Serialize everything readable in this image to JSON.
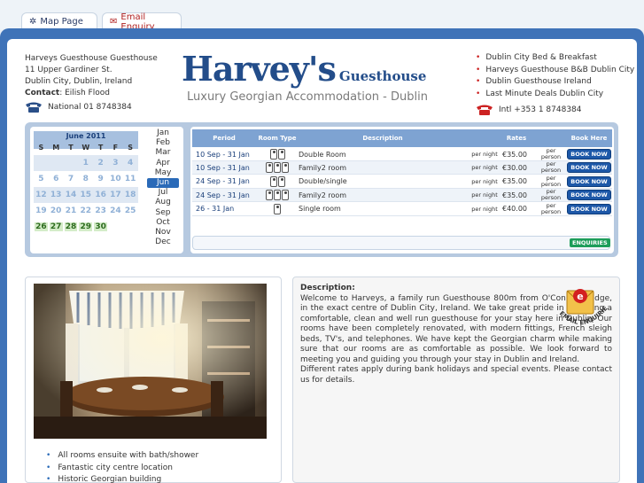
{
  "tabs": [
    {
      "label": "Map Page",
      "icon": "map-icon"
    },
    {
      "label": "Email Enquiry",
      "icon": "envelope-icon"
    }
  ],
  "address": {
    "line1": "Harveys Guesthouse Guesthouse",
    "line2": "11 Upper Gardiner St.",
    "line3": "Dublin City, Dublin, Ireland",
    "contact_label": "Contact",
    "contact_name": ": Eilish Flood",
    "phone": "National 01 8748384"
  },
  "logo": {
    "name": "Harvey's",
    "suffix": "Guesthouse",
    "tagline": "Luxury Georgian Accommodation - Dublin"
  },
  "right_links": [
    "Dublin City Bed & Breakfast",
    "Harveys Guesthouse B&B Dublin City",
    "Dublin Guesthouse Ireland",
    "Last Minute Deals Dublin City"
  ],
  "intl_phone": "Intl +353 1 8748384",
  "calendar": {
    "title": "June 2011",
    "dow": [
      "S",
      "M",
      "T",
      "W",
      "T",
      "F",
      "S"
    ],
    "weeks": [
      [
        "",
        "",
        "",
        "1",
        "2",
        "3",
        "4"
      ],
      [
        "5",
        "6",
        "7",
        "8",
        "9",
        "10",
        "11"
      ],
      [
        "12",
        "13",
        "14",
        "15",
        "16",
        "17",
        "18"
      ],
      [
        "19",
        "20",
        "21",
        "22",
        "23",
        "24",
        "25"
      ],
      [
        "26",
        "27",
        "28",
        "29",
        "30",
        "",
        ""
      ]
    ],
    "months": [
      "Jan",
      "Feb",
      "Mar",
      "Apr",
      "May",
      "Jun",
      "Jul",
      "Aug",
      "Sep",
      "Oct",
      "Nov",
      "Dec"
    ],
    "selected_month": "Jun"
  },
  "rates": {
    "headers": {
      "period": "Period",
      "room_type": "Room Type",
      "description": "Description",
      "rates": "Rates",
      "book": "Book Here"
    },
    "per_night": "per night",
    "per_person": "per person",
    "book_label": "BOOK NOW",
    "enquiries_label": "ENQUIRIES",
    "rows": [
      {
        "period": "10 Sep - 31 Jan",
        "persons": 2,
        "description": "Double Room",
        "price": "€35.00"
      },
      {
        "period": "10 Sep - 31 Jan",
        "persons": 3,
        "description": "Family2 room",
        "price": "€30.00"
      },
      {
        "period": "24 Sep - 31 Jan",
        "persons": 2,
        "description": "Double/single",
        "price": "€35.00"
      },
      {
        "period": "24 Sep - 31 Jan",
        "persons": 3,
        "description": "Family2 room",
        "price": "€35.00"
      },
      {
        "period": "26 - 31 Jan",
        "persons": 1,
        "description": "Single room",
        "price": "€40.00"
      }
    ]
  },
  "features": [
    "All rooms ensuite with bath/shower",
    "Fantastic city centre location",
    "Historic Georgian building"
  ],
  "description": {
    "heading": "Description:",
    "paragraph1": "Welcome to Harveys, a family run Guesthouse 800m from O'Connell Bridge, in the exact centre of Dublin City, Ireland. We take great pride in providing a comfortable, clean and well run guesthouse for your stay here in Dublin. Our rooms have been completely renovated, with modern fittings, French sleigh beds, TV's, and telephones. We have kept the Georgian charm while making sure that our rooms are as comfortable as possible. We look forward to meeting you and guiding you through your stay in Dublin and Ireland.",
    "paragraph2": "Different rates apply during bank holidays and special events. Please contact us for details.",
    "badge_text": "EMAIL ENQUIRIES",
    "badge_letter": "e"
  },
  "colors": {
    "frame": "#3f73b8",
    "logo": "#234d8a",
    "accent_red": "#b02020",
    "book_button": "#1d58a8",
    "enquiries_button": "#1d9d5a"
  }
}
